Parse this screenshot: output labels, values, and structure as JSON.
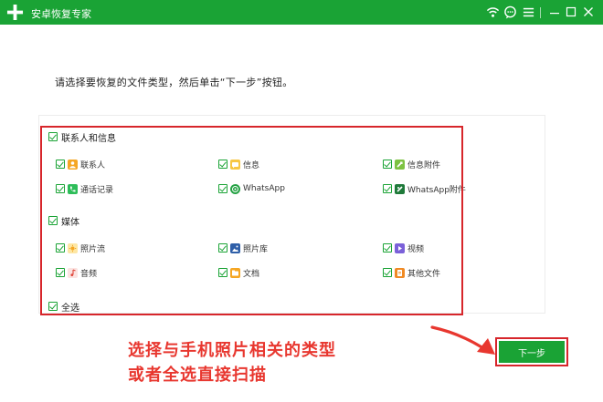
{
  "app": {
    "title": "安卓恢复专家"
  },
  "colors": {
    "brand_green": "#1aa335",
    "highlight_red": "#d7262b",
    "annotation_red": "#e8372f"
  },
  "window_controls": [
    "wifi-icon",
    "chat-icon",
    "menu-icon",
    "minimize-icon",
    "maximize-icon",
    "close-icon"
  ],
  "instruction": "请选择要恢复的文件类型，然后单击“下一步”按钮。",
  "groups": {
    "contacts": {
      "label": "联系人和信息",
      "items": [
        {
          "label": "联系人",
          "icon": "contacts-icon",
          "checked": true
        },
        {
          "label": "信息",
          "icon": "messages-icon",
          "checked": true
        },
        {
          "label": "信息附件",
          "icon": "message-attachment-icon",
          "checked": true
        },
        {
          "label": "通话记录",
          "icon": "call-log-icon",
          "checked": true
        },
        {
          "label": "WhatsApp",
          "icon": "whatsapp-icon",
          "checked": true
        },
        {
          "label": "WhatsApp附件",
          "icon": "whatsapp-attachment-icon",
          "checked": true
        }
      ]
    },
    "media": {
      "label": "媒体",
      "items": [
        {
          "label": "照片流",
          "icon": "photo-stream-icon",
          "checked": true
        },
        {
          "label": "照片库",
          "icon": "photo-library-icon",
          "checked": true
        },
        {
          "label": "视频",
          "icon": "video-icon",
          "checked": true
        },
        {
          "label": "音频",
          "icon": "audio-icon",
          "checked": true
        },
        {
          "label": "文档",
          "icon": "document-icon",
          "checked": true
        },
        {
          "label": "其他文件",
          "icon": "other-files-icon",
          "checked": true
        }
      ]
    }
  },
  "select_all": {
    "label": "全选",
    "checked": true
  },
  "annotation": {
    "line1": "选择与手机照片相关的类型",
    "line2": "或者全选直接扫描"
  },
  "next_button": "下一步"
}
